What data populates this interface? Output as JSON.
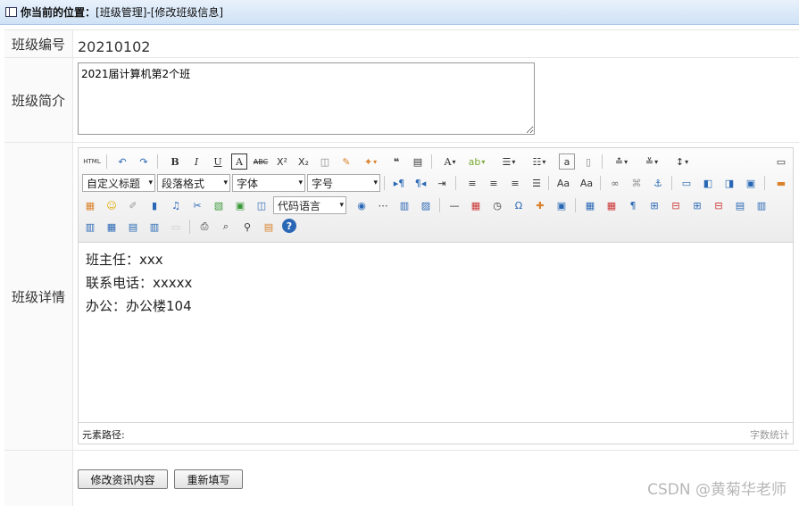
{
  "breadcrumb": {
    "prefix": "你当前的位置：",
    "path": "[班级管理]-[修改班级信息]"
  },
  "form": {
    "class_no_label": "班级编号",
    "class_no_value": "20210102",
    "intro_label": "班级简介",
    "intro_value": "2021届计算机第2个班",
    "detail_label": "班级详情"
  },
  "editor": {
    "toolbar": {
      "row2_selects": [
        "自定义标题",
        "段落格式",
        "字体",
        "字号"
      ],
      "row3_select": "代码语言"
    },
    "content_lines": [
      "班主任：xxx",
      "联系电话：xxxxx",
      "办公：办公楼104"
    ],
    "element_path": "元素路径:",
    "word_count": "字数统计"
  },
  "buttons": {
    "submit": "修改资讯内容",
    "reset": "重新填写"
  },
  "watermark": "CSDN @黄菊华老师",
  "colors": {
    "crumb_bg": "#d9e8f8",
    "label_bg": "#fafafa",
    "border": "#e6e6e6"
  }
}
